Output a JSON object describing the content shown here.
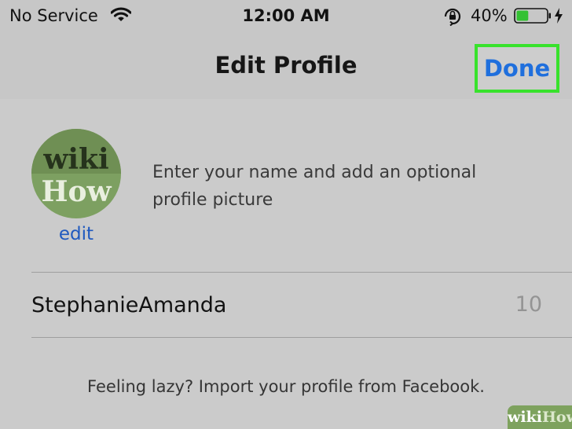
{
  "status_bar": {
    "carrier": "No Service",
    "time": "12:00 AM",
    "battery_percent": "40%",
    "battery_level": 0.4,
    "icons": [
      "wifi-icon",
      "orientation-lock-icon",
      "battery-icon",
      "charging-bolt-icon"
    ]
  },
  "nav": {
    "title": "Edit Profile",
    "done_label": "Done",
    "done_highlight_color": "#38e22c"
  },
  "profile": {
    "avatar_text_line1": "wiki",
    "avatar_text_line2": "How",
    "edit_label": "edit",
    "intro_text": "Enter your name and add an optional profile picture"
  },
  "name_field": {
    "value": "StephanieAmanda",
    "char_count": "10"
  },
  "facebook_import_text": "Feeling lazy? Import your profile from Facebook.",
  "watermark": {
    "prefix": "wiki",
    "suffix": "How"
  },
  "colors": {
    "accent": "#1f6fdd",
    "highlight": "#38e22c",
    "background": "#cbcbcb"
  }
}
